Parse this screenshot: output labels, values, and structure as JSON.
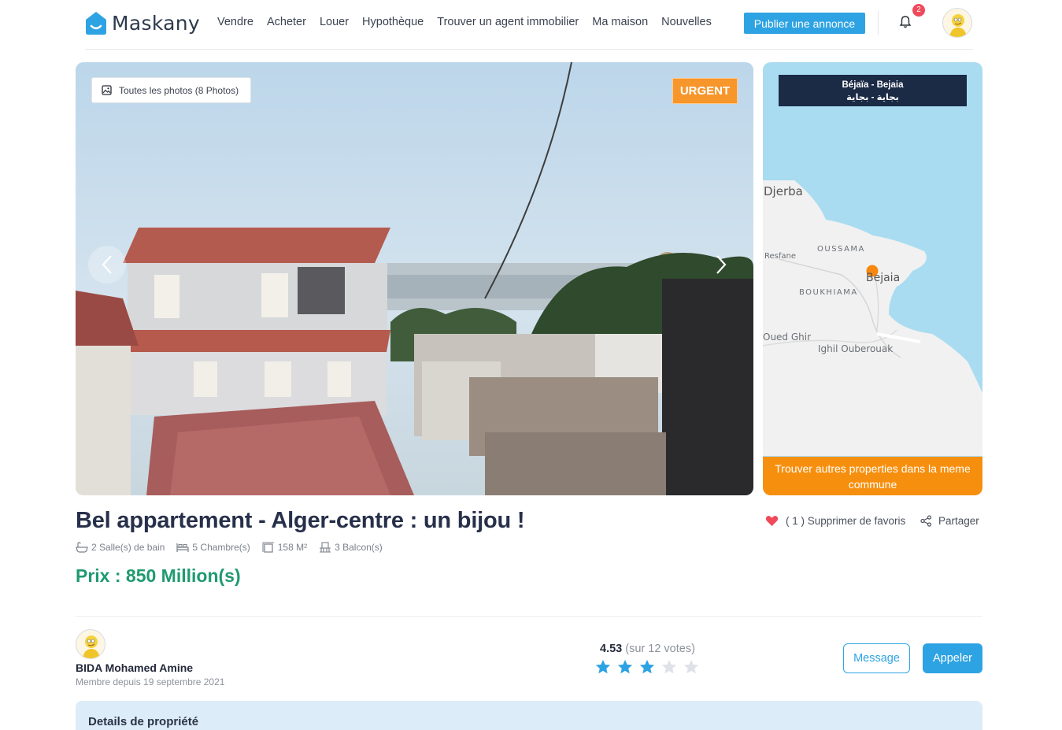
{
  "header": {
    "logo_text": "Maskany",
    "nav": [
      "Vendre",
      "Acheter",
      "Louer",
      "Hypothèque",
      "Trouver un agent immobilier",
      "Ma maison",
      "Nouvelles"
    ],
    "publish_label": "Publier une annonce",
    "notification_count": "2"
  },
  "gallery": {
    "all_photos_label": "Toutes les photos (8 Photos)",
    "badge": "URGENT"
  },
  "map": {
    "location_fr": "Béjaïa - Bejaia",
    "location_ar": "بجاية - بجاية",
    "labels": {
      "djerba": "Djerba",
      "oussama": "OUSSAMA",
      "resfane": "Resfane",
      "bejaia": "Bejaia",
      "boukhiama": "BOUKHIAMA",
      "oued_ghir": "Oued Ghir",
      "ighil": "Ighil Ouberouak"
    },
    "button_label": "Trouver autres properties dans la meme commune"
  },
  "listing": {
    "title": "Bel appartement - Alger-centre : un bijou !",
    "features": {
      "bath": "2 Salle(s) de bain",
      "rooms": "5 Chambre(s)",
      "area": "158 M²",
      "balcony": "3 Balcon(s)"
    },
    "price": "Prix : 850 Million(s)",
    "favorite_label": "( 1 ) Supprimer de favoris",
    "share_label": "Partager"
  },
  "owner": {
    "name": "BIDA Mohamed Amine",
    "since": "Membre depuis 19 septembre 2021",
    "rating": "4.53",
    "votes": "(sur 12 votes)",
    "stars_filled": 3,
    "stars_total": 5,
    "message_label": "Message",
    "call_label": "Appeler"
  },
  "details": {
    "title": "Details de propriété"
  },
  "colors": {
    "primary": "#2ea3e3",
    "accent": "#f7962b",
    "price": "#1f9a6f",
    "dark": "#1b2a45",
    "heart": "#ef4a5a"
  }
}
